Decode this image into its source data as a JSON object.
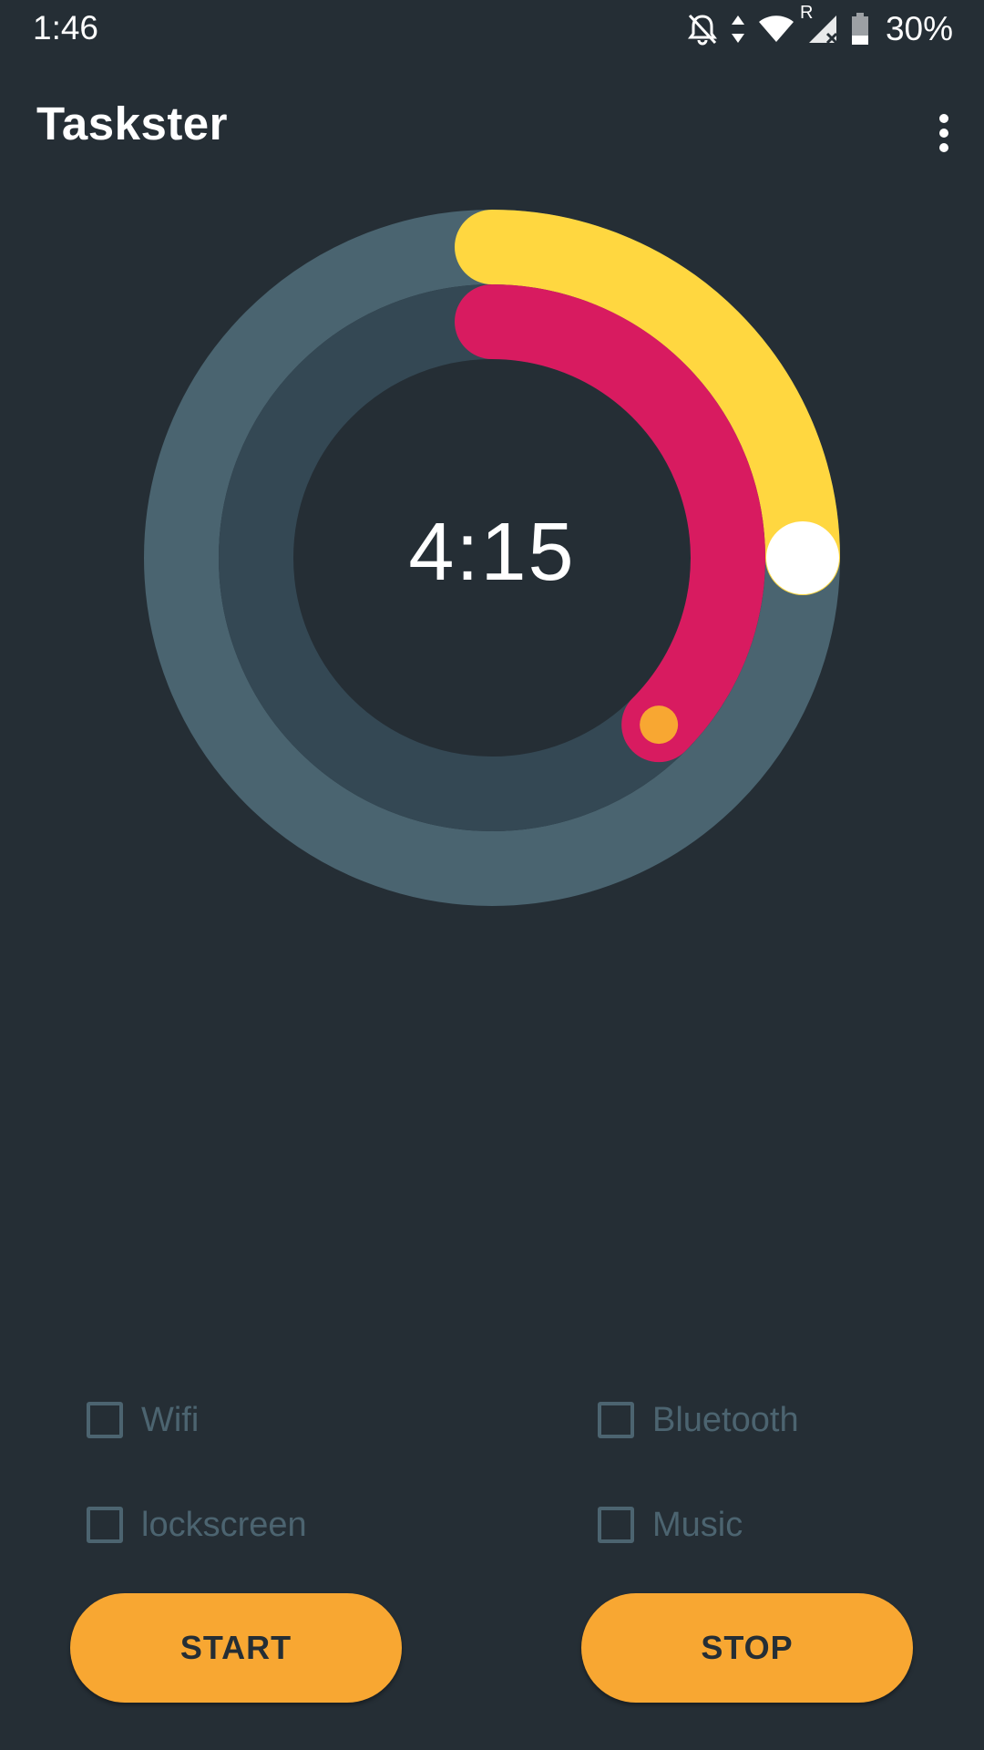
{
  "status_bar": {
    "time": "1:46",
    "battery": "30%",
    "icons": [
      "bell-off-icon",
      "data-arrows-icon",
      "wifi-icon",
      "roaming-signal-icon",
      "battery-icon"
    ],
    "roaming_label": "R"
  },
  "app_bar": {
    "title": "Taskster",
    "overflow_icon": "more-vert-icon"
  },
  "timer": {
    "display": "4:15",
    "outer_progress": 0.25,
    "inner_progress": 0.375,
    "colors": {
      "outer_track": "#4a6470",
      "inner_track": "#344854",
      "outer_arc": "#ffd740",
      "inner_arc": "#d81b60",
      "outer_knob": "#ffffff",
      "inner_knob": "#f8a732"
    }
  },
  "options": [
    {
      "label": "Wifi",
      "checked": false
    },
    {
      "label": "Bluetooth",
      "checked": false
    },
    {
      "label": "lockscreen",
      "checked": false
    },
    {
      "label": "Music",
      "checked": false
    }
  ],
  "buttons": {
    "start": "START",
    "stop": "STOP"
  },
  "colors": {
    "background": "#252e35",
    "accent": "#f8a732",
    "muted": "#4c6470"
  }
}
